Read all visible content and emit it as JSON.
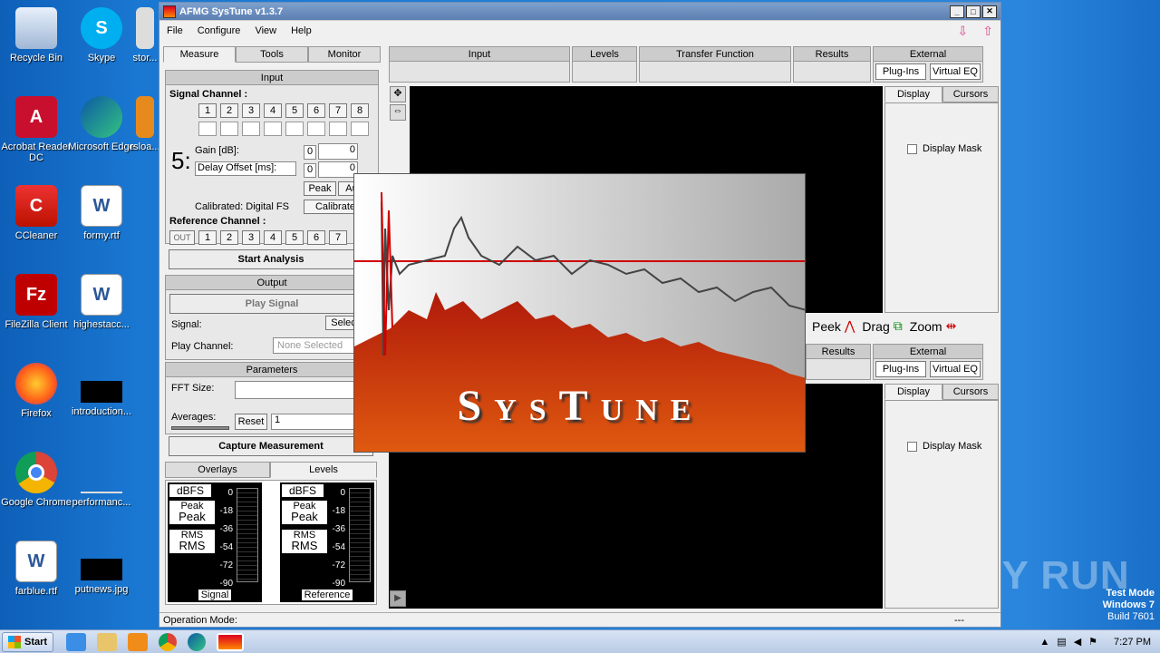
{
  "desktop": {
    "icons": [
      {
        "label": "Recycle Bin",
        "icon": "recycle-bin-icon"
      },
      {
        "label": "Skype",
        "icon": "skype-icon"
      },
      {
        "label": "stor...",
        "icon": "file-icon"
      },
      {
        "label": "Acrobat Reader DC",
        "icon": "acrobat-icon"
      },
      {
        "label": "Microsoft Edge",
        "icon": "edge-icon"
      },
      {
        "label": "rsloa...",
        "icon": "file-icon"
      },
      {
        "label": "CCleaner",
        "icon": "ccleaner-icon"
      },
      {
        "label": "formy.rtf",
        "icon": "word-icon"
      },
      {
        "label": "FileZilla Client",
        "icon": "filezilla-icon"
      },
      {
        "label": "highestacc...",
        "icon": "word-icon"
      },
      {
        "label": "Firefox",
        "icon": "firefox-icon"
      },
      {
        "label": "introduction...",
        "icon": "black-file-icon"
      },
      {
        "label": "Google Chrome",
        "icon": "chrome-icon"
      },
      {
        "label": "performanc...",
        "icon": "file-icon"
      },
      {
        "label": "farblue.rtf",
        "icon": "word-icon"
      },
      {
        "label": "putnews.jpg",
        "icon": "black-file-icon"
      }
    ],
    "watermark": "ANY RUN",
    "test_mode": [
      "Test Mode",
      "Windows 7",
      "Build 7601"
    ]
  },
  "window": {
    "title": "AFMG SysTune v1.3.7",
    "menu": [
      "File",
      "Configure",
      "View",
      "Help"
    ]
  },
  "left": {
    "tabs": [
      "Measure",
      "Tools",
      "Monitor"
    ],
    "input_header": "Input",
    "signal_channel": "Signal Channel :",
    "channels": [
      "1",
      "2",
      "3",
      "4",
      "5",
      "6",
      "7",
      "8"
    ],
    "big_number": "5:",
    "gain_label": "Gain [dB]:",
    "delay_label": "Delay Offset [ms]:",
    "gain_zero": "0",
    "gain_value": "0",
    "delay_zero": "0",
    "delay_value": "0",
    "peak_btn": "Peak",
    "auto_btn": "Au",
    "calibrated": "Calibrated: Digital FS",
    "calibrate_btn": "Calibrate",
    "reference_channel": "Reference Channel :",
    "out": "OUT",
    "start_analysis": "Start Analysis",
    "output_header": "Output",
    "play_signal": "Play Signal",
    "signal_label": "Signal:",
    "select_btn": "Selec",
    "play_channel_label": "Play Channel:",
    "none_selected": "None Selected",
    "parameters_header": "Parameters",
    "fft_label": "FFT Size:",
    "averages_label": "Averages:",
    "reset_btn": "Reset",
    "averages_value": "1",
    "capture": "Capture Measurement",
    "bottom_tabs": [
      "Overlays",
      "Levels"
    ],
    "meters": [
      {
        "unit": "dBFS",
        "peak_small": "Peak",
        "peak_big": "Peak",
        "rms_small": "RMS",
        "rms_big": "RMS",
        "label": "Signal",
        "scale": [
          "0",
          "-18",
          "-36",
          "-54",
          "-72",
          "-90"
        ]
      },
      {
        "unit": "dBFS",
        "peak_small": "Peak",
        "peak_big": "Peak",
        "rms_small": "RMS",
        "rms_big": "RMS",
        "label": "Reference",
        "scale": [
          "0",
          "-18",
          "-36",
          "-54",
          "-72",
          "-90"
        ]
      }
    ]
  },
  "top_headers": [
    "Input",
    "Levels",
    "Transfer Function",
    "Results",
    "External"
  ],
  "external_buttons": [
    "Plug-Ins",
    "Virtual EQ"
  ],
  "right_tabs": [
    "Display",
    "Cursors"
  ],
  "display_mask": "Display Mask",
  "toolbar": {
    "peak": "Peek",
    "drag": "Drag",
    "zoom": "Zoom"
  },
  "lower_headers": [
    "Results",
    "External"
  ],
  "splash": {
    "title": "SysTune",
    "colors": {
      "top": "#b8b8b8",
      "bottom": "#c0300a",
      "line": "#d00000"
    }
  },
  "status": {
    "mode": "Operation Mode:",
    "dashes": "---"
  },
  "taskbar": {
    "start": "Start",
    "time": "7:27 PM"
  }
}
